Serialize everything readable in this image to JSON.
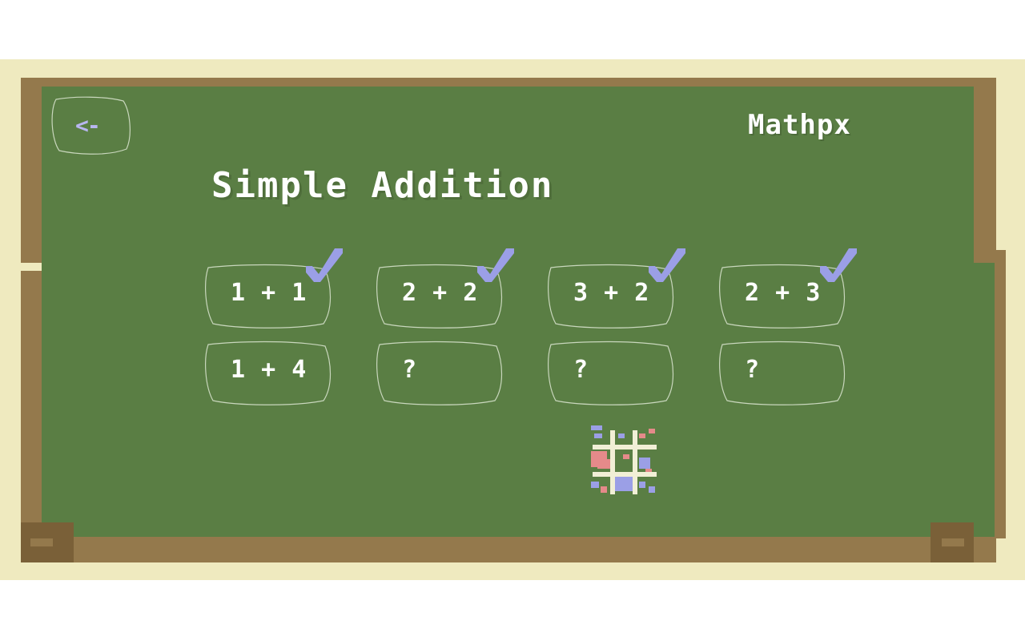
{
  "app": {
    "name": "Mathpx"
  },
  "nav": {
    "back_label": "<-"
  },
  "page": {
    "title": "Simple Addition"
  },
  "levels": [
    {
      "label": "1 + 1",
      "completed": true
    },
    {
      "label": "2 + 2",
      "completed": true
    },
    {
      "label": "3 + 2",
      "completed": true
    },
    {
      "label": "2 + 3",
      "completed": true
    },
    {
      "label": "1 + 4",
      "completed": false
    },
    {
      "label": "?",
      "completed": false
    },
    {
      "label": "?",
      "completed": false
    },
    {
      "label": "?",
      "completed": false
    }
  ],
  "icons": {
    "check": "check-icon",
    "minigame": "tic-tac-toe-icon"
  },
  "colors": {
    "board": "#5a7e44",
    "frame": "#94794c",
    "background": "#efeabf",
    "check": "#9b9fe6",
    "text": "#ffffff"
  }
}
